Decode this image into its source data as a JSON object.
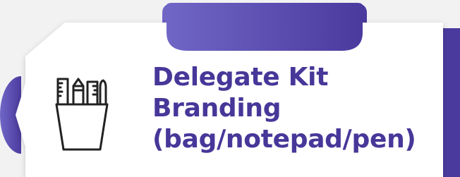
{
  "card": {
    "title_lines": [
      "Delegate Kit",
      "Branding",
      "(bag/notepad/pen)"
    ],
    "icon": "stationery-cup-icon"
  },
  "colors": {
    "accent": "#4b3a9e",
    "accent_light": "#7066c6",
    "title": "#473799",
    "card_bg": "#ffffff",
    "page_bg": "#f2f2f3",
    "icon_stroke": "#222222"
  }
}
